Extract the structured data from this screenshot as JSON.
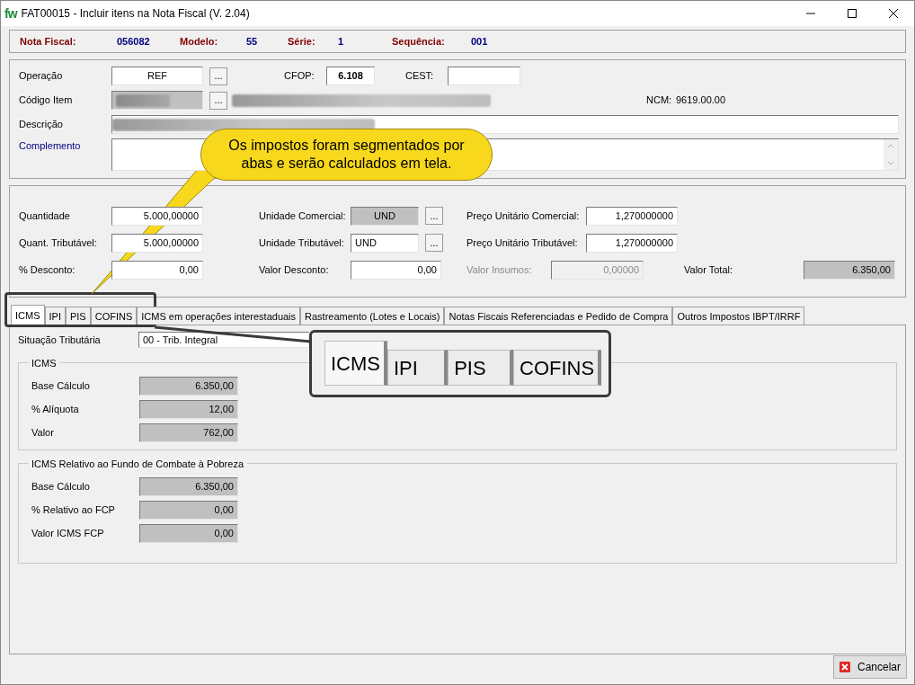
{
  "window": {
    "logo": "fw",
    "title": "FAT00015 - Incluir itens na Nota Fiscal (V. 2.04)"
  },
  "header": [
    {
      "label": "Nota Fiscal:",
      "value": "056082"
    },
    {
      "label": "Modelo:",
      "value": "55"
    },
    {
      "label": "Série:",
      "value": "1"
    },
    {
      "label": "Sequência:",
      "value": "001"
    }
  ],
  "item": {
    "operacao": {
      "label": "Operação",
      "value": "REF",
      "lookup": "..."
    },
    "cfop": {
      "label": "CFOP:",
      "value": "6.108"
    },
    "cest": {
      "label": "CEST:"
    },
    "codigo": {
      "label": "Código Item",
      "redacted": true,
      "lookup": "..."
    },
    "ncm": {
      "label": "NCM:",
      "value": "9619.00.00"
    },
    "descricao": {
      "label": "Descrição",
      "redacted": true
    },
    "complemento": {
      "label": "Complemento"
    }
  },
  "quantities": [
    [
      {
        "kind": "left",
        "label": "Quantidade",
        "value": "5.000,00000",
        "readonly": false,
        "disabled": false
      },
      {
        "kind": "mid",
        "label": "Unidade Comercial:",
        "value": "UND",
        "readonly": true,
        "disabled": false,
        "lookup": "..."
      },
      {
        "kind": "right",
        "label": "Preço Unitário Comercial:",
        "value": "1,270000000",
        "readonly": false,
        "disabled": false
      }
    ],
    [
      {
        "kind": "left",
        "label": "Quant. Tributável:",
        "value": "5.000,00000",
        "readonly": false,
        "disabled": false
      },
      {
        "kind": "mid",
        "label": "Unidade Tributável:",
        "value": "UND",
        "readonly": false,
        "disabled": false,
        "lookup": "..."
      },
      {
        "kind": "right",
        "label": "Preço Unitário Tributável:",
        "value": "1,270000000",
        "readonly": false,
        "disabled": false
      }
    ],
    [
      {
        "kind": "left",
        "label": "% Desconto:",
        "value": "0,00",
        "readonly": false,
        "disabled": false
      },
      {
        "kind": "mid",
        "label": "Valor Desconto:",
        "value": "0,00",
        "readonly": false,
        "disabled": false
      },
      {
        "kind": "extra",
        "label": "Valor Insumos:",
        "value": "0,00000",
        "readonly": false,
        "disabled": true
      },
      {
        "kind": "right",
        "label": "Valor Total:",
        "value": "6.350,00",
        "readonly": true,
        "disabled": false
      }
    ]
  ],
  "tabs": [
    {
      "label": "ICMS",
      "selected": true
    },
    {
      "label": "IPI",
      "selected": false
    },
    {
      "label": "PIS",
      "selected": false
    },
    {
      "label": "COFINS",
      "selected": false
    },
    {
      "label": "ICMS em operações interestaduais",
      "selected": false
    },
    {
      "label": "Rastreamento (Lotes e Locais)",
      "selected": false
    },
    {
      "label": "Notas Fiscais Referenciadas e Pedido de Compra",
      "selected": false
    },
    {
      "label": "Outros Impostos IBPT/IRRF",
      "selected": false
    }
  ],
  "situacao": {
    "label": "Situação Tributária",
    "value": "00  - Trib. Integral"
  },
  "groups": [
    {
      "title": "ICMS",
      "fields": [
        {
          "label": "Base Cálculo",
          "value": "6.350,00"
        },
        {
          "label": "% Alíquota",
          "value": "12,00"
        },
        {
          "label": "Valor",
          "value": "762,00"
        }
      ]
    },
    {
      "title": "ICMS Relativo ao Fundo de Combate à Pobreza",
      "fields": [
        {
          "label": "Base Cálculo",
          "value": "6.350,00"
        },
        {
          "label": "% Relativo ao FCP",
          "value": "0,00"
        },
        {
          "label": "Valor ICMS FCP",
          "value": "0,00"
        }
      ]
    }
  ],
  "callout": {
    "text": "Os impostos foram segmentados por abas e serão calculados em tela."
  },
  "zoom_tabs": [
    {
      "label": "ICMS",
      "selected": true
    },
    {
      "label": "IPI",
      "selected": false
    },
    {
      "label": "PIS",
      "selected": false
    },
    {
      "label": "COFINS",
      "selected": false
    }
  ],
  "cancel_button": {
    "label": "Cancelar"
  }
}
